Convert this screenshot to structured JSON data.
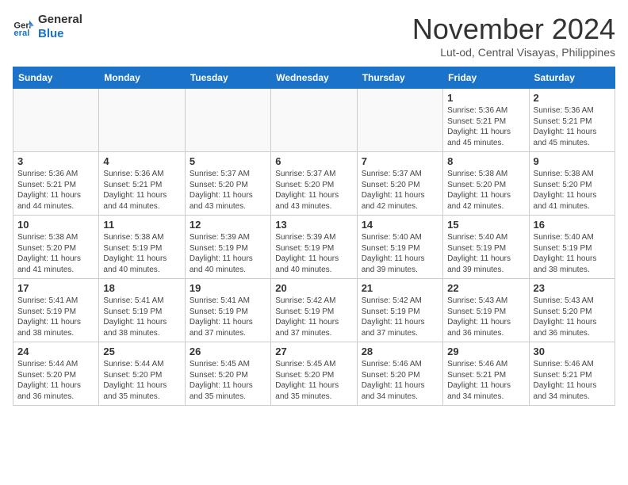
{
  "header": {
    "logo_line1": "General",
    "logo_line2": "Blue",
    "month": "November 2024",
    "location": "Lut-od, Central Visayas, Philippines"
  },
  "days_of_week": [
    "Sunday",
    "Monday",
    "Tuesday",
    "Wednesday",
    "Thursday",
    "Friday",
    "Saturday"
  ],
  "weeks": [
    [
      {
        "day": "",
        "info": ""
      },
      {
        "day": "",
        "info": ""
      },
      {
        "day": "",
        "info": ""
      },
      {
        "day": "",
        "info": ""
      },
      {
        "day": "",
        "info": ""
      },
      {
        "day": "1",
        "info": "Sunrise: 5:36 AM\nSunset: 5:21 PM\nDaylight: 11 hours and 45 minutes."
      },
      {
        "day": "2",
        "info": "Sunrise: 5:36 AM\nSunset: 5:21 PM\nDaylight: 11 hours and 45 minutes."
      }
    ],
    [
      {
        "day": "3",
        "info": "Sunrise: 5:36 AM\nSunset: 5:21 PM\nDaylight: 11 hours and 44 minutes."
      },
      {
        "day": "4",
        "info": "Sunrise: 5:36 AM\nSunset: 5:21 PM\nDaylight: 11 hours and 44 minutes."
      },
      {
        "day": "5",
        "info": "Sunrise: 5:37 AM\nSunset: 5:20 PM\nDaylight: 11 hours and 43 minutes."
      },
      {
        "day": "6",
        "info": "Sunrise: 5:37 AM\nSunset: 5:20 PM\nDaylight: 11 hours and 43 minutes."
      },
      {
        "day": "7",
        "info": "Sunrise: 5:37 AM\nSunset: 5:20 PM\nDaylight: 11 hours and 42 minutes."
      },
      {
        "day": "8",
        "info": "Sunrise: 5:38 AM\nSunset: 5:20 PM\nDaylight: 11 hours and 42 minutes."
      },
      {
        "day": "9",
        "info": "Sunrise: 5:38 AM\nSunset: 5:20 PM\nDaylight: 11 hours and 41 minutes."
      }
    ],
    [
      {
        "day": "10",
        "info": "Sunrise: 5:38 AM\nSunset: 5:20 PM\nDaylight: 11 hours and 41 minutes."
      },
      {
        "day": "11",
        "info": "Sunrise: 5:38 AM\nSunset: 5:19 PM\nDaylight: 11 hours and 40 minutes."
      },
      {
        "day": "12",
        "info": "Sunrise: 5:39 AM\nSunset: 5:19 PM\nDaylight: 11 hours and 40 minutes."
      },
      {
        "day": "13",
        "info": "Sunrise: 5:39 AM\nSunset: 5:19 PM\nDaylight: 11 hours and 40 minutes."
      },
      {
        "day": "14",
        "info": "Sunrise: 5:40 AM\nSunset: 5:19 PM\nDaylight: 11 hours and 39 minutes."
      },
      {
        "day": "15",
        "info": "Sunrise: 5:40 AM\nSunset: 5:19 PM\nDaylight: 11 hours and 39 minutes."
      },
      {
        "day": "16",
        "info": "Sunrise: 5:40 AM\nSunset: 5:19 PM\nDaylight: 11 hours and 38 minutes."
      }
    ],
    [
      {
        "day": "17",
        "info": "Sunrise: 5:41 AM\nSunset: 5:19 PM\nDaylight: 11 hours and 38 minutes."
      },
      {
        "day": "18",
        "info": "Sunrise: 5:41 AM\nSunset: 5:19 PM\nDaylight: 11 hours and 38 minutes."
      },
      {
        "day": "19",
        "info": "Sunrise: 5:41 AM\nSunset: 5:19 PM\nDaylight: 11 hours and 37 minutes."
      },
      {
        "day": "20",
        "info": "Sunrise: 5:42 AM\nSunset: 5:19 PM\nDaylight: 11 hours and 37 minutes."
      },
      {
        "day": "21",
        "info": "Sunrise: 5:42 AM\nSunset: 5:19 PM\nDaylight: 11 hours and 37 minutes."
      },
      {
        "day": "22",
        "info": "Sunrise: 5:43 AM\nSunset: 5:19 PM\nDaylight: 11 hours and 36 minutes."
      },
      {
        "day": "23",
        "info": "Sunrise: 5:43 AM\nSunset: 5:20 PM\nDaylight: 11 hours and 36 minutes."
      }
    ],
    [
      {
        "day": "24",
        "info": "Sunrise: 5:44 AM\nSunset: 5:20 PM\nDaylight: 11 hours and 36 minutes."
      },
      {
        "day": "25",
        "info": "Sunrise: 5:44 AM\nSunset: 5:20 PM\nDaylight: 11 hours and 35 minutes."
      },
      {
        "day": "26",
        "info": "Sunrise: 5:45 AM\nSunset: 5:20 PM\nDaylight: 11 hours and 35 minutes."
      },
      {
        "day": "27",
        "info": "Sunrise: 5:45 AM\nSunset: 5:20 PM\nDaylight: 11 hours and 35 minutes."
      },
      {
        "day": "28",
        "info": "Sunrise: 5:46 AM\nSunset: 5:20 PM\nDaylight: 11 hours and 34 minutes."
      },
      {
        "day": "29",
        "info": "Sunrise: 5:46 AM\nSunset: 5:21 PM\nDaylight: 11 hours and 34 minutes."
      },
      {
        "day": "30",
        "info": "Sunrise: 5:46 AM\nSunset: 5:21 PM\nDaylight: 11 hours and 34 minutes."
      }
    ]
  ]
}
